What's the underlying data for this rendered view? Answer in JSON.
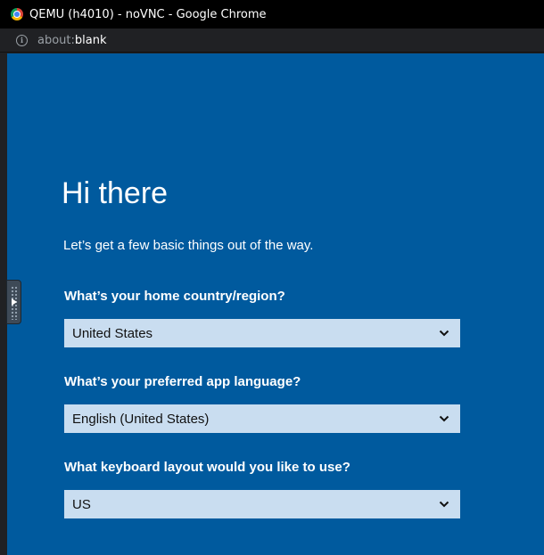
{
  "browser": {
    "window_title": "QEMU (h4010) - noVNC - Google Chrome",
    "url_scheme": "about:",
    "url_host": "blank"
  },
  "oobe": {
    "title": "Hi there",
    "subtitle": "Let’s get a few basic things out of the way.",
    "questions": [
      {
        "label": "What’s your home country/region?",
        "selected": "United States"
      },
      {
        "label": "What’s your preferred app language?",
        "selected": "English (United States)"
      },
      {
        "label": "What keyboard layout would you like to use?",
        "selected": "US"
      }
    ]
  },
  "colors": {
    "background": "#005a9e",
    "select_background": "#c9ddf0"
  }
}
